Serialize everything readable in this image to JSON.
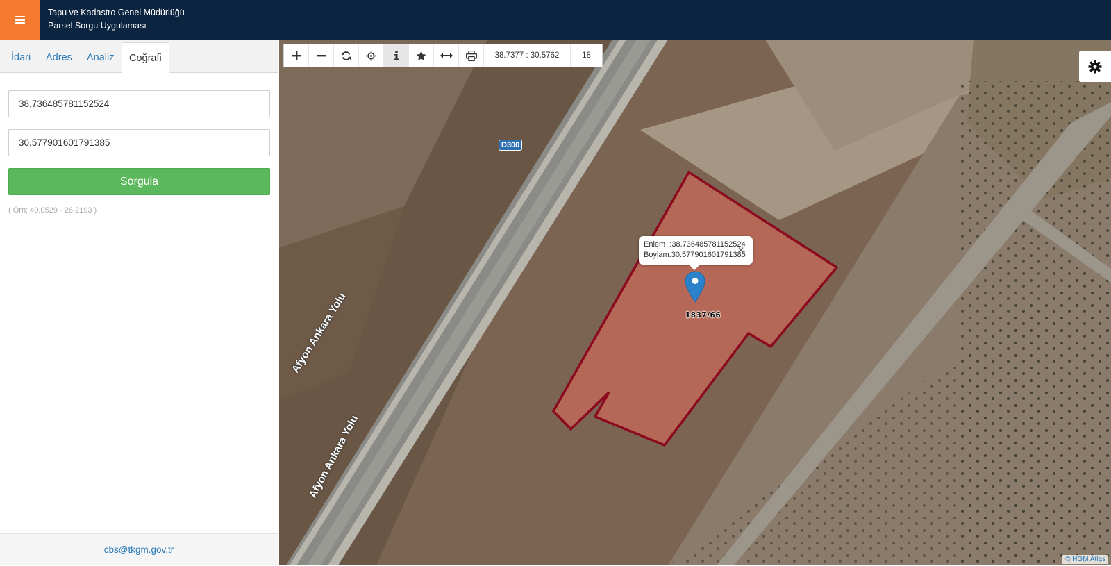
{
  "header": {
    "menu_icon": "hamburger-icon",
    "org_name": "Tapu ve Kadastro Genel Müdürlüğü",
    "app_name": "Parsel Sorgu Uygulaması",
    "accent_color": "#f57a30",
    "bg_color": "#0b2440"
  },
  "sidebar": {
    "tabs": [
      {
        "label": "İdari",
        "active": false
      },
      {
        "label": "Adres",
        "active": false
      },
      {
        "label": "Analiz",
        "active": false
      },
      {
        "label": "Coğrafi",
        "active": true
      }
    ],
    "latitude_value": "38,736485781152524",
    "longitude_value": "30,577901601791385",
    "query_button": "Sorgula",
    "query_button_color": "#5cb85c",
    "example_hint": "( Örn: 40,0529 - 26,2193 )",
    "footer_email": "cbs@tkgm.gov.tr"
  },
  "toolbar": {
    "tools": [
      {
        "name": "zoom-in-icon"
      },
      {
        "name": "zoom-out-icon"
      },
      {
        "name": "refresh-icon"
      },
      {
        "name": "locate-icon"
      },
      {
        "name": "info-icon",
        "active": true
      },
      {
        "name": "star-icon"
      },
      {
        "name": "measure-icon"
      },
      {
        "name": "print-icon"
      }
    ],
    "coordinate_readout": "38.7377 : 30.5762",
    "zoom_level": "18"
  },
  "map": {
    "popup": {
      "lat_line": "Enlem  :38.736485781152524",
      "lon_line": "Boylam:30.577901601791385",
      "close": "✕"
    },
    "parcel_label": "1837/66",
    "road_badge": "D300",
    "road_labels": [
      "Afyon Ankara Yolu",
      "Afyon Ankara Yolu"
    ],
    "attribution": "© HGM Atlas",
    "parcel_stroke_color": "#8b0a1e",
    "marker_color": "#2b82cb"
  }
}
